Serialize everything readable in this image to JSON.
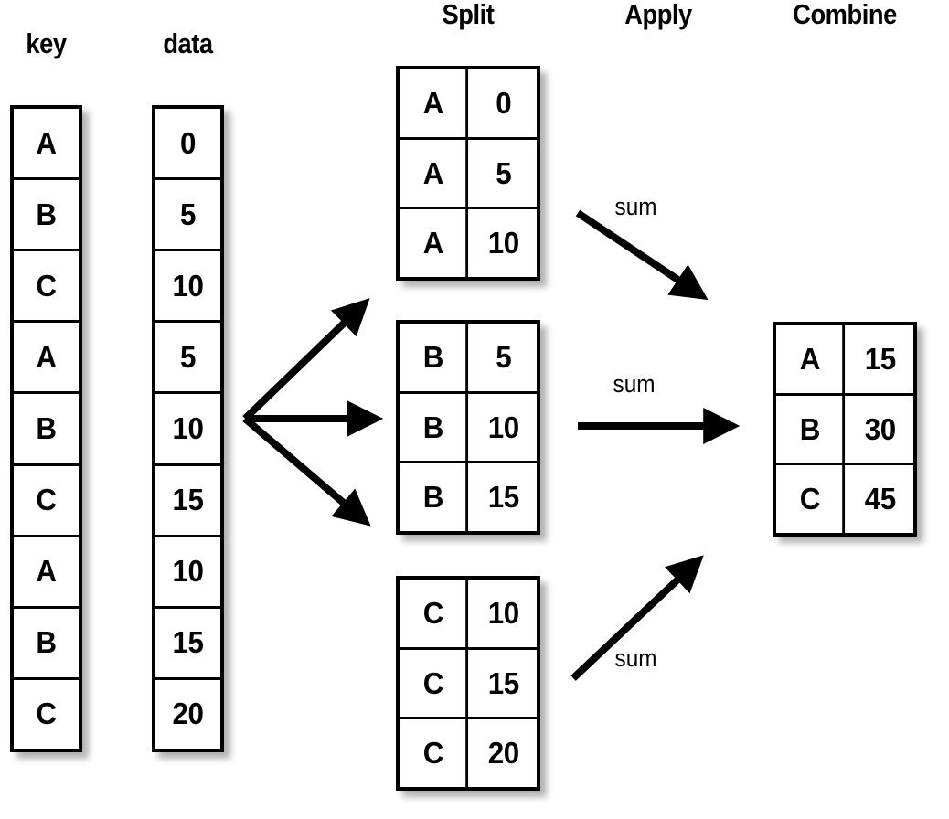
{
  "headings": {
    "key": "key",
    "data": "data",
    "split": "Split",
    "apply": "Apply",
    "combine": "Combine"
  },
  "key_column": {
    "label": "key",
    "values": [
      "A",
      "B",
      "C",
      "A",
      "B",
      "C",
      "A",
      "B",
      "C"
    ]
  },
  "data_column": {
    "label": "data",
    "values": [
      "0",
      "5",
      "10",
      "5",
      "10",
      "15",
      "10",
      "15",
      "20"
    ]
  },
  "split_tables": [
    {
      "group": "A",
      "rows": [
        {
          "key": "A",
          "value": "0"
        },
        {
          "key": "A",
          "value": "5"
        },
        {
          "key": "A",
          "value": "10"
        }
      ]
    },
    {
      "group": "B",
      "rows": [
        {
          "key": "B",
          "value": "5"
        },
        {
          "key": "B",
          "value": "10"
        },
        {
          "key": "B",
          "value": "15"
        }
      ]
    },
    {
      "group": "C",
      "rows": [
        {
          "key": "C",
          "value": "10"
        },
        {
          "key": "C",
          "value": "15"
        },
        {
          "key": "C",
          "value": "20"
        }
      ]
    }
  ],
  "apply_labels": [
    "sum",
    "sum",
    "sum"
  ],
  "combine_table": {
    "rows": [
      {
        "key": "A",
        "value": "15"
      },
      {
        "key": "B",
        "value": "30"
      },
      {
        "key": "C",
        "value": "45"
      }
    ]
  },
  "colors": {
    "stroke": "#000000",
    "background": "#ffffff",
    "shadow": "rgba(0,0,0,0.30)"
  }
}
